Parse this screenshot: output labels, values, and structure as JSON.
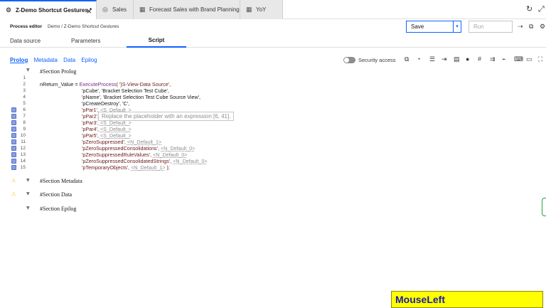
{
  "tabs": [
    {
      "label": "Z-Demo Shortcut Gestures *",
      "icon": "process-icon"
    },
    {
      "label": "Sales",
      "icon": "cube-icon"
    },
    {
      "label": "Forecast Sales with Brand Planning",
      "icon": "view-icon"
    },
    {
      "label": "YoY",
      "icon": "view-icon"
    }
  ],
  "header": {
    "title": "Process editor",
    "breadcrumb": "Demo / Z-Demo Shortcut Gestures",
    "save_label": "Save",
    "run_placeholder": "Run"
  },
  "subtabs": [
    "Data source",
    "Parameters",
    "Script"
  ],
  "script_tabs": [
    "Prolog",
    "Metadata",
    "Data",
    "Epilog"
  ],
  "security_access_label": "Security access",
  "editor": {
    "prolog_header": "#Section Prolog",
    "line_numbers": [
      "1",
      "2",
      "3",
      "4",
      "5",
      "6",
      "7",
      "8",
      "9",
      "10",
      "11",
      "12",
      "13",
      "14",
      "15"
    ],
    "lines": {
      "l2_a": "nReturn_Value = ",
      "l2_fn": "ExecuteProcess",
      "l2_b": "( '}S-View-Data Source',",
      "l3": "'pCube', 'Bracket Selection Test Cube',",
      "l4": "'pName', 'Bracket Selection Test Cube Source View',",
      "l5": "'pCreateDestroy', 'C',",
      "l6_a": "'pPar1', ",
      "l6_ph": "<S_Default_>",
      "l7_a": "'pPar2', ",
      "l8_a": "'pPar3', ",
      "l8_ph": "<S_Default_>",
      "l9_a": "'pPar4', ",
      "l9_ph": "<S_Default_>",
      "l10_a": "'pPar5', ",
      "l10_ph": "<S_Default_>",
      "l11_a": "'pZeroSuppressed', ",
      "l11_ph": "<N_Default_1>",
      "l12_a": "'pZeroSuppressedConsolidations', ",
      "l12_ph": "<N_Default_0>",
      "l13_a": "'pZeroSuppressedRuleValues', ",
      "l13_ph": "<N_Default_0>",
      "l14_a": "'pZeroSuppressedConsolidatedStrings', ",
      "l14_ph": "<N_Default_0>",
      "l15_a": "'pTemporaryObjects', ",
      "l15_ph": "<N_Default_1>",
      "l15_b": " );"
    },
    "tooltip": "Replace the placeholder with an expression [6, 41].",
    "metadata_header": "#Section Metadata",
    "data_header": "#Section Data",
    "epilog_header": "#Section Epilog"
  },
  "overlay_label": "MouseLeft",
  "colors": {
    "accent": "#0f62fe",
    "overlay_bg": "#ffff00",
    "overlay_text": "#1a1aa8"
  }
}
